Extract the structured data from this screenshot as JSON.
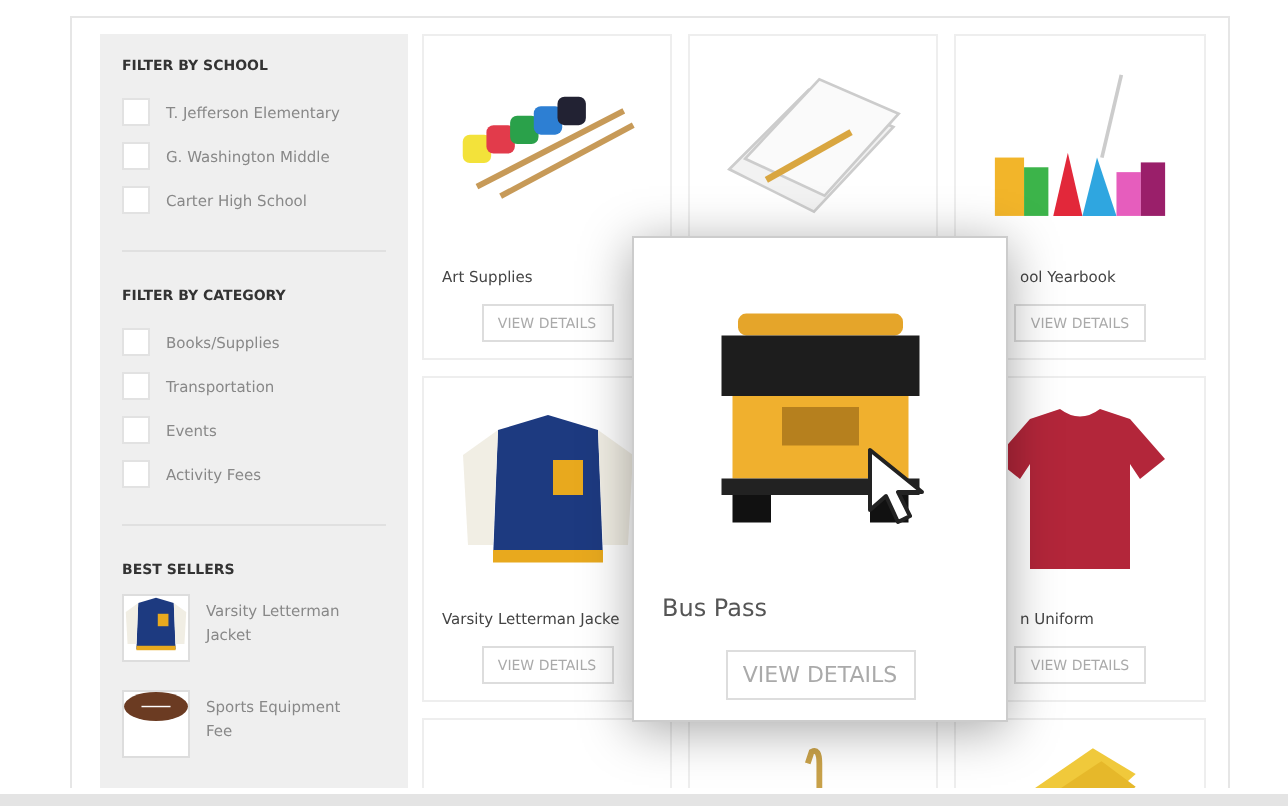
{
  "sidebar": {
    "filter_groups": [
      {
        "title": "FILTER BY SCHOOL",
        "options": [
          {
            "label": "T. Jefferson Elementary",
            "checked": false
          },
          {
            "label": "G. Washington Middle",
            "checked": false
          },
          {
            "label": "Carter High School",
            "checked": false
          }
        ]
      },
      {
        "title": "FILTER BY CATEGORY",
        "options": [
          {
            "label": "Books/Supplies",
            "checked": false
          },
          {
            "label": "Transportation",
            "checked": false
          },
          {
            "label": "Events",
            "checked": false
          },
          {
            "label": "Activity Fees",
            "checked": false
          }
        ]
      }
    ],
    "best_sellers": {
      "title": "BEST SELLERS",
      "items": [
        {
          "name": "Varsity Letterman Jacket"
        },
        {
          "name": "Sports Equipment Fee"
        }
      ]
    }
  },
  "products": [
    {
      "kind": "product",
      "name": "Art Supplies",
      "button": "VIEW DETAILS"
    },
    {
      "kind": "picture"
    },
    {
      "kind": "product",
      "name": "ool Yearbook",
      "button": "VIEW DETAILS"
    },
    {
      "kind": "product",
      "name": "Varsity Letterman Jacke",
      "button": "VIEW DETAILS"
    },
    {
      "kind": "product",
      "name": "n Uniform",
      "button": "VIEW DETAILS"
    },
    {
      "kind": "picture"
    },
    {
      "kind": "picture"
    },
    {
      "kind": "picture"
    }
  ],
  "popup": {
    "name": "Bus Pass",
    "button": "VIEW DETAILS"
  }
}
